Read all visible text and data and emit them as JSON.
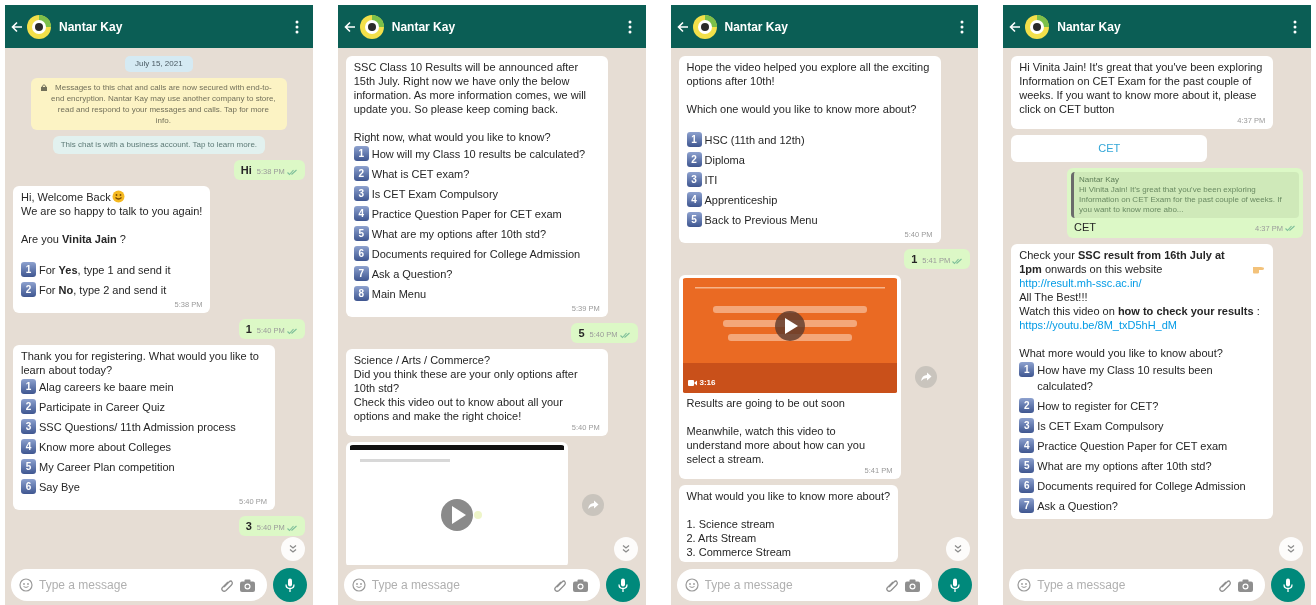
{
  "screens": [
    {
      "contact": "Nantar Kay",
      "scroll_down_button": true,
      "placeholder": "Type a message",
      "messages": [
        {
          "kind": "date",
          "text": "July 15, 2021"
        },
        {
          "kind": "notice",
          "text": "Messages to this chat and calls are now secured with end-to-end encryption. Nantar Kay may use another company to store, read and respond to your messages and calls. Tap for more info."
        },
        {
          "kind": "info",
          "text": "This chat is with a business account. Tap to learn more."
        },
        {
          "kind": "out",
          "text": "Hi",
          "time": "5:38 PM"
        },
        {
          "kind": "in",
          "time": "5:38 PM",
          "blocks": [
            {
              "kind": "smiley",
              "text": "Hi, Welcome Back"
            },
            {
              "kind": "text",
              "text": "We are so happy to talk to you again!"
            },
            {
              "kind": "gap"
            },
            {
              "kind": "text",
              "text": "Are you **Vinita Jain** ?"
            },
            {
              "kind": "gap"
            },
            {
              "kind": "option",
              "number": "1",
              "text": "For **Yes**, type 1 and send it"
            },
            {
              "kind": "option",
              "number": "2",
              "text": "For **No**, type 2 and send it"
            }
          ]
        },
        {
          "kind": "out",
          "text": "1",
          "time": "5:40 PM"
        },
        {
          "kind": "in",
          "time": "5:40 PM",
          "blocks": [
            {
              "kind": "text",
              "text": "Thank you for registering. What would you like to learn about today?"
            },
            {
              "kind": "option",
              "number": "1",
              "text": "Alag careers ke baare mein"
            },
            {
              "kind": "option",
              "number": "2",
              "text": "Participate in Career Quiz"
            },
            {
              "kind": "option",
              "number": "3",
              "text": "SSC Questions/ 11th Admission process"
            },
            {
              "kind": "option",
              "number": "4",
              "text": "Know more about Colleges"
            },
            {
              "kind": "option",
              "number": "5",
              "text": "My Career Plan competition"
            },
            {
              "kind": "option",
              "number": "6",
              "text": "Say Bye"
            }
          ]
        },
        {
          "kind": "out",
          "text": "3",
          "time": "5:40 PM"
        }
      ]
    },
    {
      "contact": "Nantar Kay",
      "scroll_down_button": true,
      "placeholder": "Type a message",
      "messages": [
        {
          "kind": "in",
          "time": "5:39 PM",
          "blocks": [
            {
              "kind": "text",
              "text": "SSC Class 10 Results will be announced after 15th July. Right now we have only the below information. As more information comes, we will update you. So please keep coming back."
            },
            {
              "kind": "gap"
            },
            {
              "kind": "text",
              "text": "Right now, what would you like to know?"
            },
            {
              "kind": "option",
              "number": "1",
              "text": "How will my Class 10 results be calculated?"
            },
            {
              "kind": "option",
              "number": "2",
              "text": "What is CET exam?"
            },
            {
              "kind": "option",
              "number": "3",
              "text": "Is CET Exam Compulsory"
            },
            {
              "kind": "option",
              "number": "4",
              "text": "Practice Question Paper for CET exam"
            },
            {
              "kind": "option",
              "number": "5",
              "text": "What are my options after 10th std?"
            },
            {
              "kind": "option",
              "number": "6",
              "text": "Documents required for College Admission"
            },
            {
              "kind": "option",
              "number": "7",
              "text": "Ask a Question?"
            },
            {
              "kind": "option",
              "number": "8",
              "text": "Main Menu"
            }
          ]
        },
        {
          "kind": "out",
          "text": "5",
          "time": "5:40 PM"
        },
        {
          "kind": "in",
          "time": "5:40 PM",
          "blocks": [
            {
              "kind": "text",
              "text": "Science / Arts / Commerce?"
            },
            {
              "kind": "text",
              "text": "Did you think these are your only options after 10th std?"
            },
            {
              "kind": "text",
              "text": "Check this video out to know about all your options and make the right choice!"
            }
          ]
        },
        {
          "kind": "video",
          "forward": true
        }
      ]
    },
    {
      "contact": "Nantar Kay",
      "scroll_down_button": true,
      "placeholder": "Type a message",
      "messages": [
        {
          "kind": "in",
          "time": "5:40 PM",
          "blocks": [
            {
              "kind": "text",
              "text": "Hope the video helped you explore all the exciting options after 10th!"
            },
            {
              "kind": "gap"
            },
            {
              "kind": "text",
              "text": "Which one would you like to know more about?"
            },
            {
              "kind": "gap"
            },
            {
              "kind": "option",
              "number": "1",
              "text": "HSC (11th and 12th)"
            },
            {
              "kind": "option",
              "number": "2",
              "text": "Diploma"
            },
            {
              "kind": "option",
              "number": "3",
              "text": "ITI"
            },
            {
              "kind": "option",
              "number": "4",
              "text": "Apprenticeship"
            },
            {
              "kind": "option",
              "number": "5",
              "text": "Back to Previous Menu"
            }
          ]
        },
        {
          "kind": "out",
          "text": "1",
          "time": "5:41 PM"
        },
        {
          "kind": "video",
          "forward": true,
          "duration": "3:16",
          "time": "5:41 PM",
          "blocks": [
            {
              "kind": "text",
              "text": "Results are going to be out soon"
            },
            {
              "kind": "gap"
            },
            {
              "kind": "text",
              "text": "Meanwhile, watch this video to understand more about how can you select a stream."
            }
          ]
        },
        {
          "kind": "in",
          "blocks": [
            {
              "kind": "text",
              "text": "What would you like to know more about?"
            },
            {
              "kind": "gap"
            },
            {
              "kind": "text",
              "text": "1. Science stream"
            },
            {
              "kind": "text",
              "text": "2. Arts Stream"
            },
            {
              "kind": "text",
              "text": "3. Commerce Stream"
            }
          ]
        }
      ]
    },
    {
      "contact": "Nantar Kay",
      "scroll_down_button": true,
      "placeholder": "Type a message",
      "messages": [
        {
          "kind": "in",
          "time": "4:37 PM",
          "blocks": [
            {
              "kind": "text",
              "text": "Hi Vinita Jain! It's great that you've been exploring Information on CET Exam for the past couple of weeks. If you want to know more about it, please click on CET button"
            }
          ]
        },
        {
          "kind": "button",
          "text": "CET"
        },
        {
          "kind": "reply",
          "author": "Nantar Kay",
          "quote": "Hi Vinita Jain! It's great that you've been exploring Information on CET Exam for the past couple of weeks. If you want to know more abo...",
          "text": "CET",
          "time": "4:37 PM"
        },
        {
          "kind": "in",
          "blocks": [
            {
              "kind": "pointer",
              "text": "Check your **SSC result from 16th July at 1pm** onwards on this website"
            },
            {
              "kind": "link",
              "text": "http://result.mh-ssc.ac.in/"
            },
            {
              "kind": "text",
              "text": "All The Best!!!"
            },
            {
              "kind": "text",
              "text": "Watch this video on **how to check your results** :",
              "link": "https://youtu.be/8M_txD5hH_dM"
            },
            {
              "kind": "gap"
            },
            {
              "kind": "text",
              "text": "What more would you like to know about?"
            },
            {
              "kind": "option",
              "number": "1",
              "text": "How have my Class 10 results been calculated?"
            },
            {
              "kind": "option",
              "number": "2",
              "text": "How to register for CET?"
            },
            {
              "kind": "option",
              "number": "3",
              "text": "Is CET Exam Compulsory"
            },
            {
              "kind": "option",
              "number": "4",
              "text": "Practice Question Paper for CET exam"
            },
            {
              "kind": "option",
              "number": "5",
              "text": "What are my options after 10th std?"
            },
            {
              "kind": "option",
              "number": "6",
              "text": "Documents required for College Admission"
            },
            {
              "kind": "option",
              "number": "7",
              "text": "Ask a Question?"
            }
          ]
        }
      ]
    }
  ]
}
